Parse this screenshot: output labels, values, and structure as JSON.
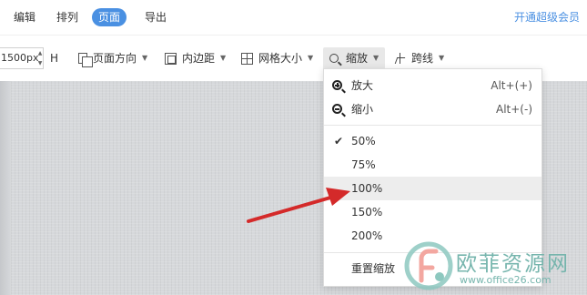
{
  "tabs": [
    {
      "label": "编辑",
      "active": false
    },
    {
      "label": "排列",
      "active": false
    },
    {
      "label": "页面",
      "active": true
    },
    {
      "label": "导出",
      "active": false
    }
  ],
  "vip_label": "开通超级会员",
  "toolbar": {
    "width_value": "1500px",
    "height_label": "H",
    "page_orientation": "页面方向",
    "margin": "内边距",
    "grid_size": "网格大小",
    "zoom": "缩放",
    "jump_line": "跨线"
  },
  "zoom_menu": {
    "zoom_in": {
      "label": "放大",
      "shortcut": "Alt+(+)"
    },
    "zoom_out": {
      "label": "缩小",
      "shortcut": "Alt+(-)"
    },
    "levels": [
      {
        "label": "50%",
        "checked": true
      },
      {
        "label": "75%",
        "checked": false
      },
      {
        "label": "100%",
        "checked": false,
        "highlighted": true
      },
      {
        "label": "150%",
        "checked": false
      },
      {
        "label": "200%",
        "checked": false
      }
    ],
    "reset": "重置缩放"
  },
  "watermark": {
    "brand": "欧菲资源网",
    "url": "www.office26.com"
  },
  "colors": {
    "accent": "#4a90e2",
    "canvas": "#d6d8db",
    "arrow": "#d42a2a",
    "watermark": "#76b5ad"
  }
}
